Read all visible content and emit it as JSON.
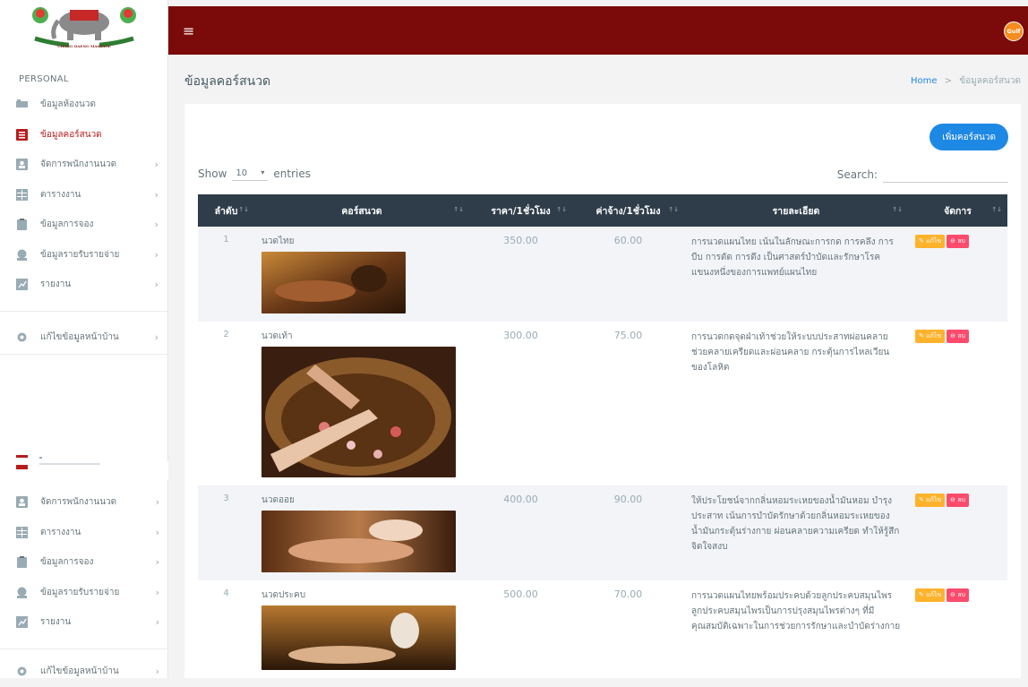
{
  "logo": {
    "text": "CHANG DAENG MASSAGE"
  },
  "topbar": {
    "menu_icon": "≡",
    "brand": "Gulf"
  },
  "sidebar": {
    "section_label": "PERSONAL",
    "items": [
      {
        "label": "ข้อมูลห้องนวด",
        "icon": "bed-icon"
      },
      {
        "label": "ข้อมูลคอร์สนวด",
        "icon": "list-icon",
        "active": true
      },
      {
        "label": "จัดการพนักงานนวด",
        "icon": "person-icon"
      },
      {
        "label": "ตารางงาน",
        "icon": "table-icon"
      },
      {
        "label": "ข้อมูลการจอง",
        "icon": "clipboard-icon"
      },
      {
        "label": "ข้อมูลรายรับรายจ่าย",
        "icon": "money-icon"
      },
      {
        "label": "รายงาน",
        "icon": "report-icon"
      }
    ],
    "settings": {
      "label": "แก้ไขข้อมูลหน้าบ้าน"
    },
    "items2": [
      {
        "label": "จัดการพนักงานนวด"
      },
      {
        "label": "ตารางงาน"
      },
      {
        "label": "ข้อมูลการจอง"
      },
      {
        "label": "ข้อมูลรายรับรายจ่าย"
      },
      {
        "label": "รายงาน"
      }
    ],
    "settings2": {
      "label": "แก้ไขข้อมูลหน้าบ้าน"
    }
  },
  "page": {
    "title": "ข้อมูลคอร์สนวด"
  },
  "breadcrumb": {
    "home": "Home",
    "sep": ">",
    "current": "ข้อมูลคอร์สนวด"
  },
  "toolbar": {
    "add_label": "เพิ่มคอร์สนวด",
    "show_label": "Show",
    "entries_value": "10",
    "entries_label": "entries",
    "search_label": "Search:"
  },
  "table": {
    "headers": [
      "ลำดับ",
      "คอร์สนวด",
      "ราคา/1ชั่วโมง",
      "ค่าจ้าง/1ชั่วโมง",
      "รายละเอียด",
      "จัดการ"
    ],
    "edit_label": "แก้ไข",
    "delete_label": "ลบ",
    "rows": [
      {
        "no": "1",
        "name": "นวดไทย",
        "price": "350.00",
        "wage": "60.00",
        "detail": "การนวดแผนไทย เน้นในลักษณะการกด การคลึง การบีบ การดัด การดึง เป็นศาสตร์บำบัดและรักษาโรคแขนงหนึ่งของการแพทย์แผนไทย"
      },
      {
        "no": "2",
        "name": "นวดเท้า",
        "price": "300.00",
        "wage": "75.00",
        "detail": "การนวดกดจุดฝ่าเท้าช่วยให้ระบบประสาทผ่อนคลาย ช่วยคลายเครียดและผ่อนคลาย กระตุ้นการไหลเวียนของโลหิต"
      },
      {
        "no": "3",
        "name": "นวดออย",
        "price": "400.00",
        "wage": "90.00",
        "detail": "ให้ประโยชน์จากกลิ่นหอมระเหยของน้ำมันหอม บำรุงประสาท เน้นการบำบัดรักษาด้วยกลิ่นหอมระเหยของน้ำมันกระตุ้นร่างกาย ผ่อนคลายความเครียด ทำให้รู้สึกจิตใจสงบ"
      },
      {
        "no": "4",
        "name": "นวดประคบ",
        "price": "500.00",
        "wage": "70.00",
        "detail": "การนวดแผนไทยพร้อมประคบด้วยลูกประคบสมุนไพร ลูกประคบสมุนไพรเป็นการปรุงสมุนไพรต่างๆ ที่มีคุณสมบัติเฉพาะในการช่วยการรักษาและบำบัดร่างกาย"
      }
    ]
  }
}
